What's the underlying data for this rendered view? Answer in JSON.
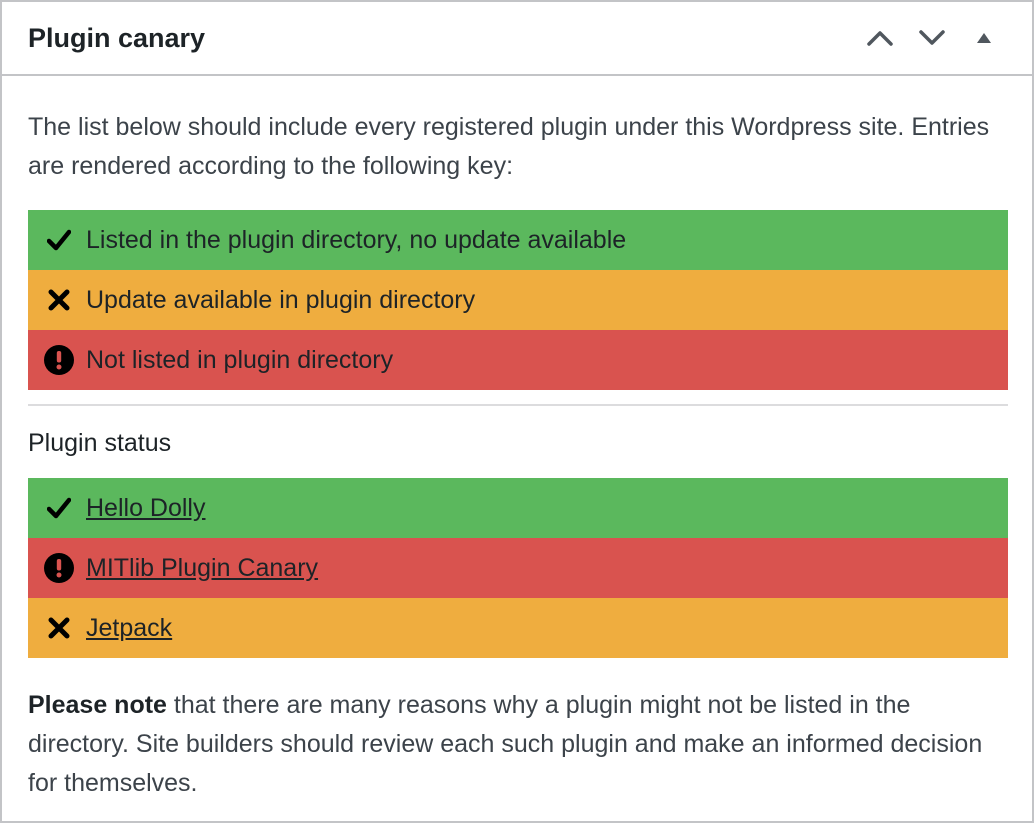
{
  "panel": {
    "title": "Plugin canary",
    "move_up_label": "Move up",
    "move_down_label": "Move down",
    "toggle_label": "Toggle panel"
  },
  "intro_text": "The list below should include every registered plugin under this Wordpress site. Entries are rendered according to the following key:",
  "key": [
    {
      "status": "ok",
      "icon": "checkmark-icon",
      "label": "Listed in the plugin directory, no update available"
    },
    {
      "status": "update",
      "icon": "x-icon",
      "label": "Update available in plugin directory"
    },
    {
      "status": "notlisted",
      "icon": "exclamation-icon",
      "label": "Not listed in plugin directory"
    }
  ],
  "status_heading": "Plugin status",
  "plugins": [
    {
      "status": "ok",
      "icon": "checkmark-icon",
      "name": "Hello Dolly"
    },
    {
      "status": "notlisted",
      "icon": "exclamation-icon",
      "name": "MITlib Plugin Canary"
    },
    {
      "status": "update",
      "icon": "x-icon",
      "name": "Jetpack"
    }
  ],
  "note": {
    "bold": "Please note",
    "rest": " that there are many reasons why a plugin might not be listed in the directory. Site builders should review each such plugin and make an informed decision for themselves."
  },
  "colors": {
    "ok": "#5bb85d",
    "update": "#efad3f",
    "notlisted": "#d9534f",
    "border": "#c3c4c7"
  }
}
